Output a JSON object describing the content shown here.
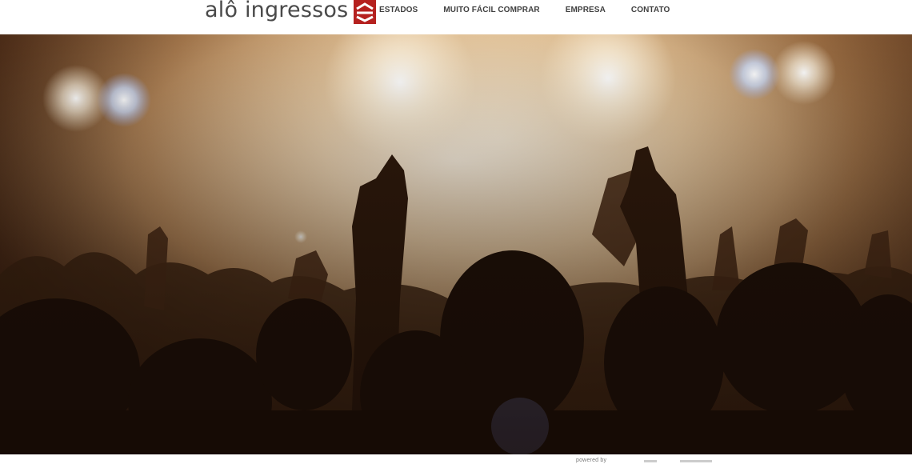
{
  "header": {
    "logo": {
      "text": "alô ingressos",
      "mark_icon": "ticket-logo-icon",
      "mark_color": "#b5211f"
    },
    "nav": [
      {
        "label": "ESTADOS"
      },
      {
        "label": "MUITO FÁCIL COMPRAR"
      },
      {
        "label": "EMPRESA"
      },
      {
        "label": "CONTATO"
      }
    ]
  },
  "hero": {
    "image": "concert-crowd-hands-raised-stage-lights",
    "tone": "#d9b486"
  },
  "footer": {
    "powered_by": "powered by"
  }
}
